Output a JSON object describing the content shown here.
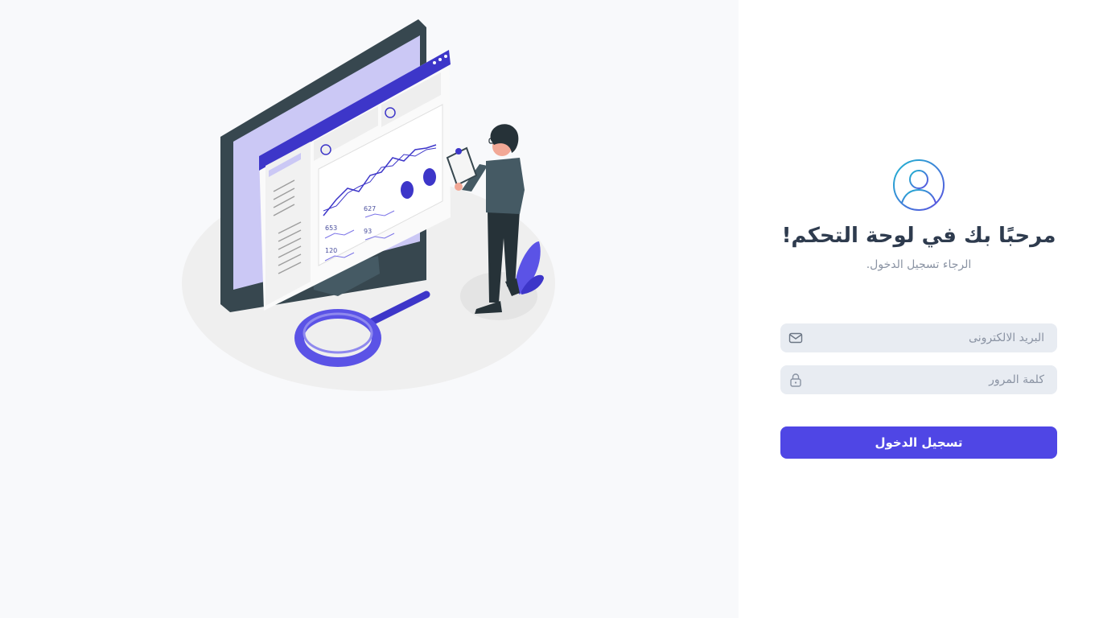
{
  "login": {
    "avatar_icon": "user-circle-icon",
    "title": "مرحبًا بك في لوحة التحكم!",
    "subtitle": "الرجاء تسجيل الدخول.",
    "email": {
      "placeholder": "البريد الالكترونى",
      "value": "",
      "icon": "envelope-icon"
    },
    "password": {
      "placeholder": "كلمة المرور",
      "value": "",
      "icon": "lock-icon"
    },
    "submit_label": "تسجيل الدخول"
  },
  "illustration": {
    "description_icon": "analytics-illustration",
    "stat_values": [
      "627",
      "653",
      "93",
      "120"
    ]
  },
  "colors": {
    "accent": "#4f46e5",
    "illustration_purple": "#3d36c9",
    "illustration_lavender": "#cbc8f5",
    "title_text": "#2e3b4e",
    "muted_text": "#8a93a3",
    "input_bg": "#e8ecf2",
    "panel_bg": "#f8f9fb"
  }
}
